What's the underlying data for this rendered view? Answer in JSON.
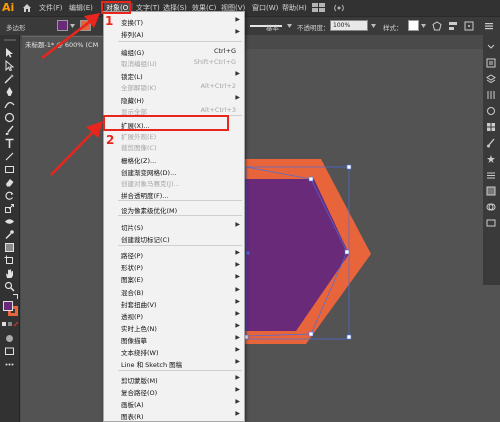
{
  "app": {
    "logo": "Ai"
  },
  "menubar": {
    "items": [
      {
        "label": "文件(F)"
      },
      {
        "label": "编辑(E)"
      },
      {
        "label": "对象(O)"
      },
      {
        "label": "文字(T)"
      },
      {
        "label": "选择(S)"
      },
      {
        "label": "效果(C)"
      },
      {
        "label": "视图(V)"
      },
      {
        "label": "窗口(W)"
      },
      {
        "label": "帮助(H)"
      }
    ]
  },
  "controlbar": {
    "shape_type": "多边形",
    "stroke_style": "基本",
    "opacity_label": "不透明度：",
    "opacity_value": "100%",
    "style_label": "样式："
  },
  "document": {
    "tab_title": "未标题-1* @ 600% (CM"
  },
  "object_menu": {
    "items": [
      {
        "label": "变换(T)",
        "shortcut": "",
        "submenu": true,
        "disabled": false
      },
      {
        "label": "排列(A)",
        "shortcut": "",
        "submenu": true,
        "disabled": false
      },
      {
        "label": "编组(G)",
        "shortcut": "Ctrl+G",
        "submenu": false,
        "disabled": false
      },
      {
        "label": "取消编组(U)",
        "shortcut": "Shift+Ctrl+G",
        "submenu": false,
        "disabled": true
      },
      {
        "label": "锁定(L)",
        "shortcut": "",
        "submenu": true,
        "disabled": false
      },
      {
        "label": "全部解锁(K)",
        "shortcut": "Alt+Ctrl+2",
        "submenu": false,
        "disabled": true
      },
      {
        "label": "隐藏(H)",
        "shortcut": "",
        "submenu": true,
        "disabled": false
      },
      {
        "label": "显示全部",
        "shortcut": "Alt+Ctrl+3",
        "submenu": false,
        "disabled": true
      },
      {
        "label": "扩展(X)...",
        "shortcut": "",
        "submenu": false,
        "disabled": false
      },
      {
        "label": "扩展外观(E)",
        "shortcut": "",
        "submenu": false,
        "disabled": true
      },
      {
        "label": "裁剪图像(C)",
        "shortcut": "",
        "submenu": false,
        "disabled": true
      },
      {
        "label": "栅格化(Z)...",
        "shortcut": "",
        "submenu": false,
        "disabled": false
      },
      {
        "label": "创建渐变网格(D)...",
        "shortcut": "",
        "submenu": false,
        "disabled": false
      },
      {
        "label": "创建对象马赛克(J)...",
        "shortcut": "",
        "submenu": false,
        "disabled": true
      },
      {
        "label": "拼合透明度(F)...",
        "shortcut": "",
        "submenu": false,
        "disabled": false
      },
      {
        "label": "设为像素级优化(M)",
        "shortcut": "",
        "submenu": false,
        "disabled": false
      },
      {
        "label": "切片(S)",
        "shortcut": "",
        "submenu": true,
        "disabled": false
      },
      {
        "label": "创建裁切标记(C)",
        "shortcut": "",
        "submenu": false,
        "disabled": false
      },
      {
        "label": "路径(P)",
        "shortcut": "",
        "submenu": true,
        "disabled": false
      },
      {
        "label": "形状(P)",
        "shortcut": "",
        "submenu": true,
        "disabled": false
      },
      {
        "label": "图案(E)",
        "shortcut": "",
        "submenu": true,
        "disabled": false
      },
      {
        "label": "混合(B)",
        "shortcut": "",
        "submenu": true,
        "disabled": false
      },
      {
        "label": "封套扭曲(V)",
        "shortcut": "",
        "submenu": true,
        "disabled": false
      },
      {
        "label": "透视(P)",
        "shortcut": "",
        "submenu": true,
        "disabled": false
      },
      {
        "label": "实时上色(N)",
        "shortcut": "",
        "submenu": true,
        "disabled": false
      },
      {
        "label": "图像描摹",
        "shortcut": "",
        "submenu": true,
        "disabled": false
      },
      {
        "label": "文本绕排(W)",
        "shortcut": "",
        "submenu": true,
        "disabled": false
      },
      {
        "label": "Line 和 Sketch 图稿",
        "shortcut": "",
        "submenu": true,
        "disabled": false
      },
      {
        "label": "剪切蒙版(M)",
        "shortcut": "",
        "submenu": true,
        "disabled": false
      },
      {
        "label": "复合路径(O)",
        "shortcut": "",
        "submenu": true,
        "disabled": false
      },
      {
        "label": "画板(A)",
        "shortcut": "",
        "submenu": true,
        "disabled": false
      },
      {
        "label": "图表(R)",
        "shortcut": "",
        "submenu": true,
        "disabled": false
      }
    ]
  },
  "annotations": {
    "step1": "1",
    "step2": "2"
  },
  "colors": {
    "fill": "#6a2a7a",
    "stroke": "#e8643a",
    "highlight": "#e8261e",
    "logo": "#ff9a00"
  }
}
